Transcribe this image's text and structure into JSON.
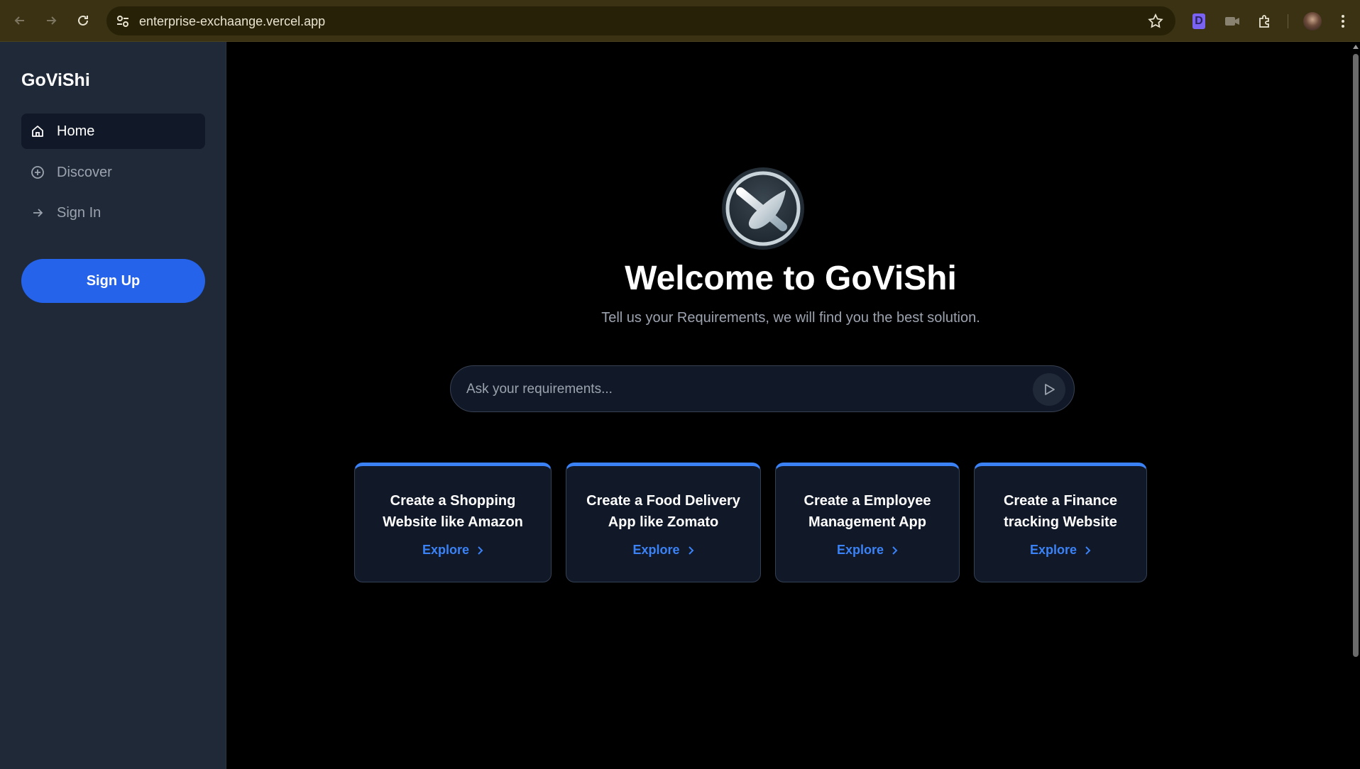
{
  "browser": {
    "url": "enterprise-exchaange.vercel.app",
    "extension_letter": "D"
  },
  "sidebar": {
    "brand": "GoViShi",
    "items": [
      {
        "label": "Home",
        "icon": "home-icon",
        "active": true
      },
      {
        "label": "Discover",
        "icon": "plus-circle-icon",
        "active": false
      },
      {
        "label": "Sign In",
        "icon": "arrow-right-icon",
        "active": false
      }
    ],
    "signup_label": "Sign Up"
  },
  "main": {
    "title": "Welcome to GoViShi",
    "subtitle": "Tell us your Requirements, we will find you the best solution.",
    "search": {
      "placeholder": "Ask your requirements...",
      "value": ""
    },
    "cards": [
      {
        "title": "Create a Shopping Website like Amazon",
        "action": "Explore"
      },
      {
        "title": "Create a Food Delivery App like Zomato",
        "action": "Explore"
      },
      {
        "title": "Create a Employee Management App",
        "action": "Explore"
      },
      {
        "title": "Create a Finance tracking Website",
        "action": "Explore"
      }
    ]
  },
  "colors": {
    "accent": "#2563eb",
    "link": "#3b82f6",
    "sidebar_bg": "#1f2937",
    "chrome_bg": "#3a3213"
  }
}
